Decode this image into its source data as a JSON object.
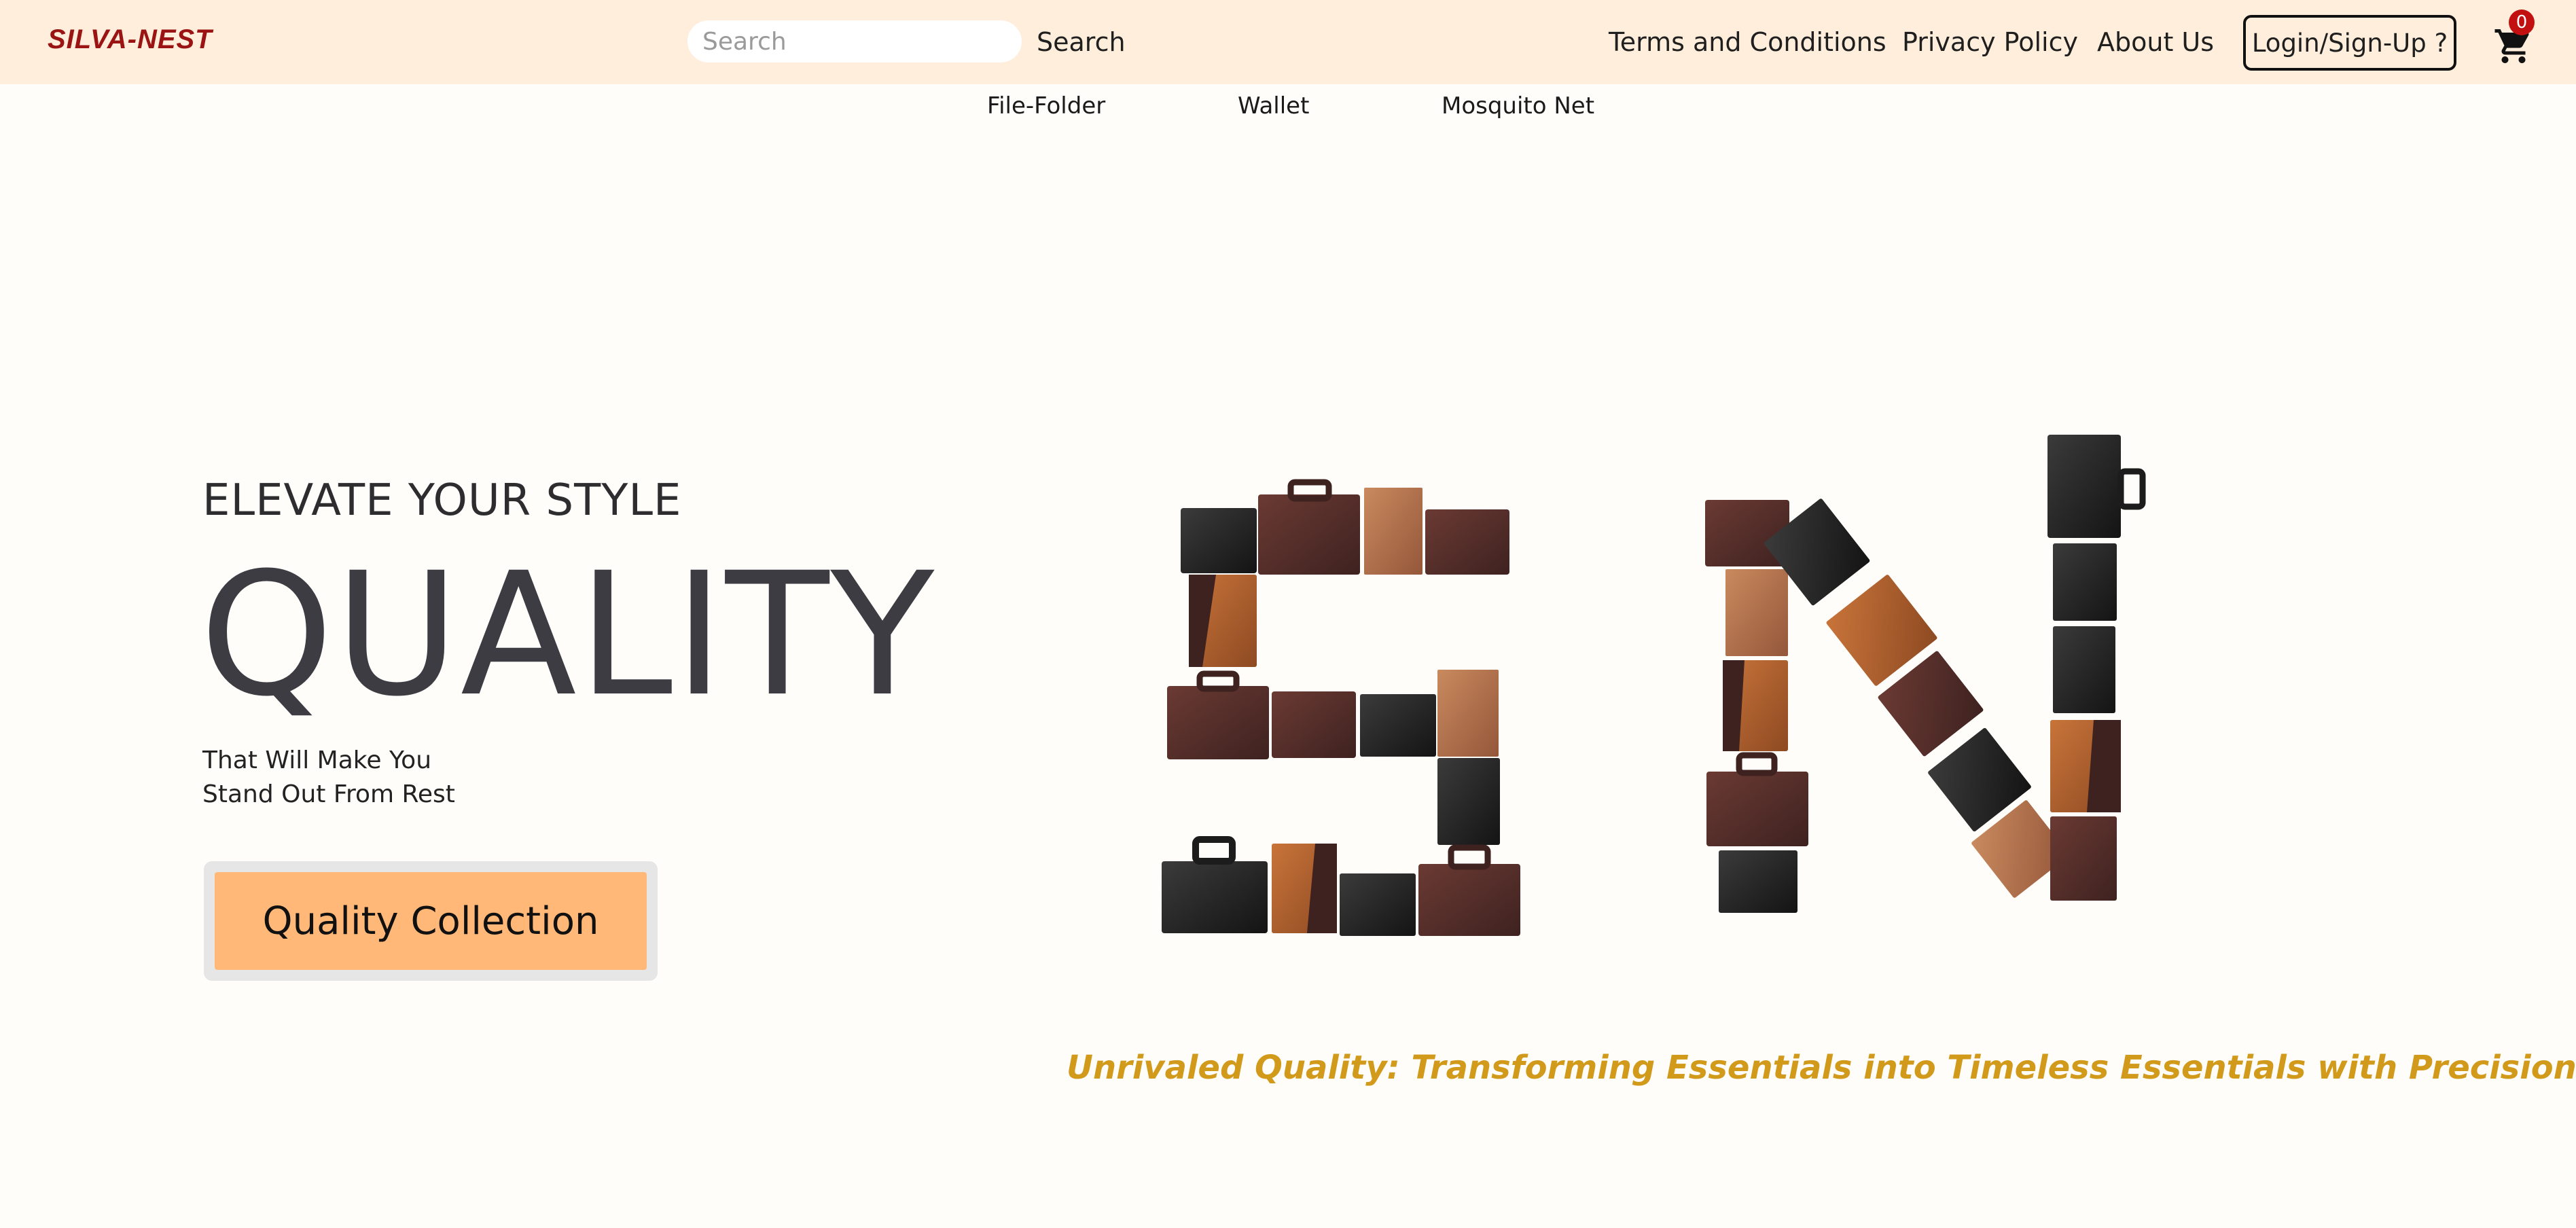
{
  "navbar": {
    "brand": "SILVA-NEST",
    "search": {
      "placeholder": "Search",
      "value": "",
      "button_label": "Search"
    },
    "links": {
      "terms": "Terms and Conditions",
      "privacy": "Privacy Policy",
      "about": "About Us"
    },
    "login_label": "Login/Sign-Up ?",
    "cart": {
      "icon": "cart-icon",
      "count": "0"
    }
  },
  "categories": [
    "File-Folder",
    "Wallet",
    "Mosquito Net"
  ],
  "hero": {
    "kicker": "ELEVATE YOUR STYLE",
    "title": "QUALITY",
    "subtitle_line1": "That Will Make You",
    "subtitle_line2": "Stand Out From Rest",
    "cta_label": "Quality Collection",
    "tagline": "Unrivaled Quality: Transforming Essentials into Timeless Essentials with Precision."
  },
  "colors": {
    "navbar_bg": "#ffeedb",
    "brand": "#9a1414",
    "cta_bg": "#ffb878",
    "tagline": "#d29a1b",
    "badge": "#c21010"
  }
}
